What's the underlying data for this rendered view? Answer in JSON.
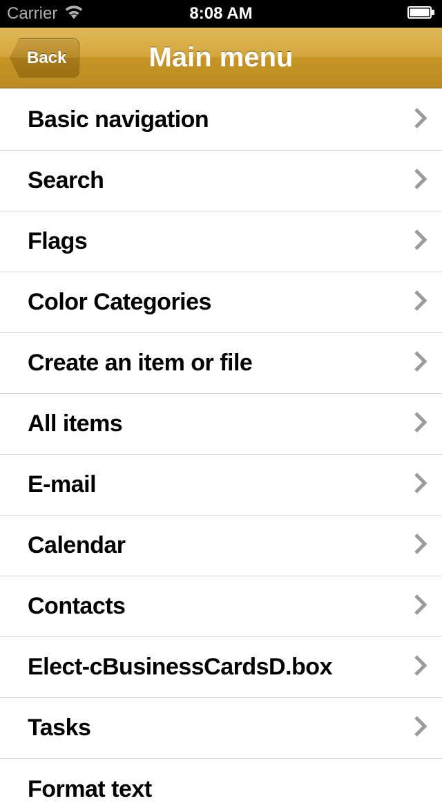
{
  "status": {
    "carrier": "Carrier",
    "time": "8:08 AM"
  },
  "nav": {
    "back_label": "Back",
    "title": "Main menu"
  },
  "menu": {
    "items": [
      {
        "label": "Basic navigation"
      },
      {
        "label": "Search"
      },
      {
        "label": "Flags"
      },
      {
        "label": "Color Categories"
      },
      {
        "label": "Create an item or file"
      },
      {
        "label": "All items"
      },
      {
        "label": "E-mail"
      },
      {
        "label": "Calendar"
      },
      {
        "label": "Contacts"
      },
      {
        "label": "Elect-cBusinessCardsD.box"
      },
      {
        "label": "Tasks"
      },
      {
        "label": "Format text"
      }
    ]
  }
}
